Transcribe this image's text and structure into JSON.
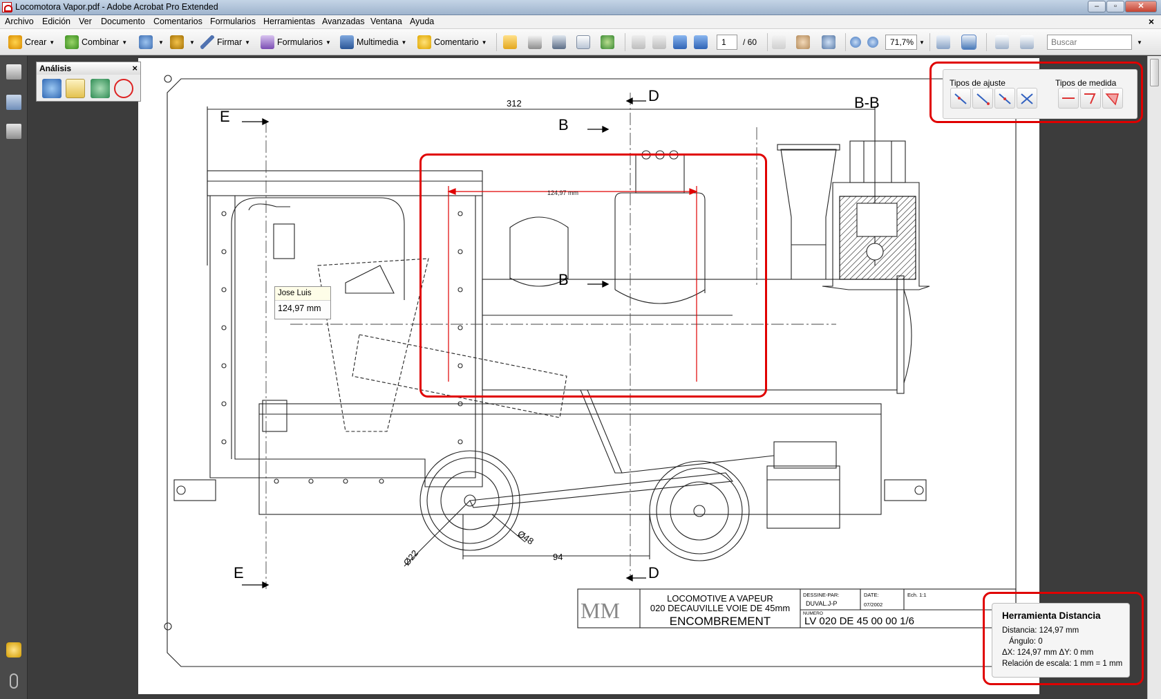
{
  "window": {
    "title": "Locomotora Vapor.pdf - Adobe Acrobat Pro Extended",
    "controls": [
      "–",
      "▫",
      "✕"
    ]
  },
  "menu": [
    "Archivo",
    "Edición",
    "Ver",
    "Documento",
    "Comentarios",
    "Formularios",
    "Herramientas",
    "Avanzadas",
    "Ventana",
    "Ayuda"
  ],
  "menu_close": "×",
  "toolbar": {
    "crear": "Crear",
    "combinar": "Combinar",
    "firmar": "Firmar",
    "formularios": "Formularios",
    "multimedia": "Multimedia",
    "comentario": "Comentario",
    "page_current": "1",
    "page_total": "/ 60",
    "zoom": "71,7%",
    "search_placeholder": "Buscar"
  },
  "analysis": {
    "title": "Análisis",
    "close": "×"
  },
  "snap": {
    "ajuste_label": "Tipos de ajuste",
    "medida_label": "Tipos de medida"
  },
  "tooltip": {
    "author": "Jose Luis",
    "value": "124,97 mm"
  },
  "distance": {
    "title": "Herramienta Distancia",
    "distancia": "Distancia: 124,97 mm",
    "angulo": "Ángulo: 0",
    "delta": "ΔX: 124,97 mm      ΔY: 0 mm",
    "escala": "Relación de escala: 1 mm = 1 mm"
  },
  "drawing": {
    "dim_312": "312",
    "dim_94": "94",
    "dim_phi22": "Ø22",
    "dim_phi48": "Ø48",
    "measure_label": "124,97 mm",
    "sec_E": "E",
    "sec_B": "B",
    "sec_D": "D",
    "sec_BB": "B-B",
    "title1": "LOCOMOTIVE A VAPEUR",
    "title2": "020 DECAUVILLE VOIE DE 45mm",
    "title3": "ENCOMBREMENT",
    "dessine_lbl": "DESSINE-PAR:",
    "dessine_val": "DUVAL.J-P",
    "date_lbl": "DATE:",
    "date_val": "07/2002",
    "ech_lbl": "Ech. 1:1",
    "numero_lbl": "NUMERO",
    "numero_val": "LV 020 DE 45 00 00 1/6",
    "logo": "MM"
  },
  "colors": {
    "accent_red": "#e00000",
    "measure_red": "#e00000"
  }
}
